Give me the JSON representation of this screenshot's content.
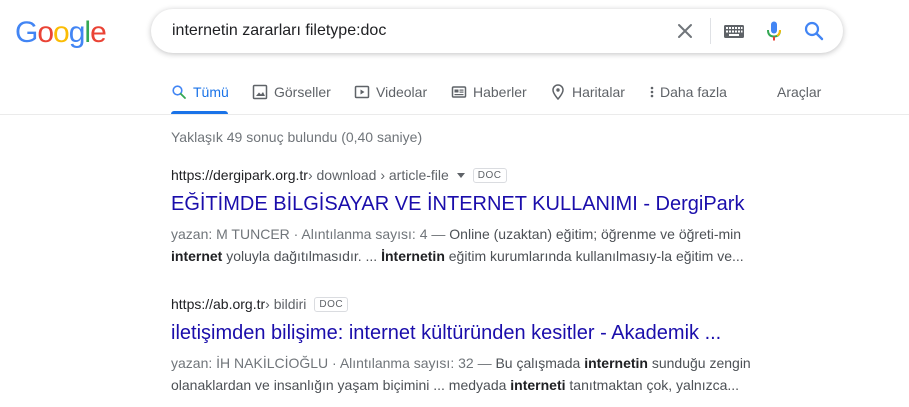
{
  "logo": {
    "text": "Google",
    "letters": [
      "G",
      "o",
      "o",
      "g",
      "l",
      "e"
    ],
    "colors": [
      "#4285F4",
      "#EA4335",
      "#FBBC05",
      "#4285F4",
      "#34A853",
      "#EA4335"
    ]
  },
  "search": {
    "query": "internetin zararları filetype:doc",
    "clear_icon": "close-icon",
    "keyboard_icon": "keyboard-icon",
    "mic_icon": "microphone-icon",
    "search_icon": "search-icon"
  },
  "tabs": {
    "all": "Tümü",
    "images": "Görseller",
    "videos": "Videolar",
    "news": "Haberler",
    "maps": "Haritalar",
    "more": "Daha fazla",
    "tools": "Araçlar",
    "active_color": "#1a73e8"
  },
  "stats": "Yaklaşık 49 sonuç bulundu (0,40 saniye)",
  "results": [
    {
      "domain": "https://dergipark.org.tr",
      "path": " › download › article-file",
      "badge": "DOC",
      "title": "EĞİTİMDE BİLGİSAYAR VE İNTERNET KULLANIMI - DergiPark",
      "meta": "yazan: M TUNCER · Alıntılanma sayısı: 4 — ",
      "line1_rest": "Online (uzaktan) eğitim; öğrenme ve öğreti-min",
      "l2_b1": "internet",
      "l2_t1": " yoluyla dağıtılmasıdır. ... ",
      "l2_b2": "İnternetin",
      "l2_t2": " eğitim kurumlarında kullanılmasıy-la eğitim ve..."
    },
    {
      "domain": "https://ab.org.tr",
      "path": " › bildiri",
      "badge": "DOC",
      "title": "iletişimden bilişime: internet kültüründen kesitler - Akademik ...",
      "meta": "yazan: İH NAKİLCİOĞLU · Alıntılanma sayısı: 32 — ",
      "l1_t1": "Bu çalışmada ",
      "l1_b1": "internetin",
      "l1_t2": " sunduğu zengin",
      "l2_t1": "olanaklardan ve insanlığın yaşam biçimini ... medyada ",
      "l2_b1": "interneti",
      "l2_t2": " tanıtmaktan çok, yalnızca..."
    }
  ]
}
